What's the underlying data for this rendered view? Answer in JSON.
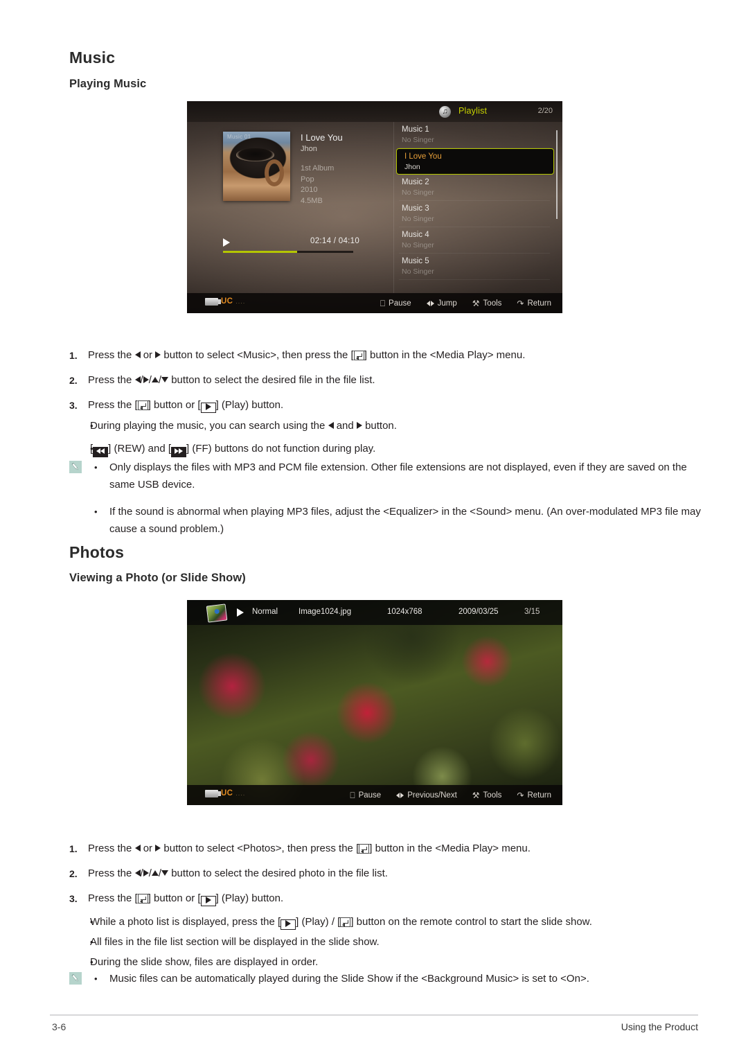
{
  "document": {
    "sections": [
      {
        "title": "Music",
        "subtitle": "Playing Music"
      },
      {
        "title": "Photos",
        "subtitle": "Viewing a Photo (or Slide Show)"
      }
    ]
  },
  "music_section": {
    "heading": "Music",
    "subheading": "Playing Music",
    "steps": [
      {
        "num": "1.",
        "parts": [
          "Press the ",
          " or ",
          " button to select <Music>, then press the [",
          "] button in the <Media Play> menu."
        ]
      },
      {
        "num": "2.",
        "parts": [
          "Press the ",
          "/",
          "/",
          "/",
          " button to select the desired file in the file list."
        ]
      },
      {
        "num": "3.",
        "parts": [
          "Press the [",
          "] button or [",
          "] (Play) button."
        ]
      }
    ],
    "bullets": [
      [
        "During playing the music, you can search using the ",
        " and ",
        " button."
      ],
      [
        "[",
        "] (REW) and [",
        "] (FF) buttons do not function during play."
      ]
    ],
    "notes": [
      "Only displays the files with MP3 and PCM file extension. Other file extensions are not displayed, even if they are saved on the same USB device.",
      "If the sound is abnormal when playing MP3 files, adjust the <Equalizer> in the <Sound> menu. (An over-modulated MP3 file may cause a sound problem.)"
    ]
  },
  "photos_section": {
    "heading": "Photos",
    "subheading": "Viewing a Photo (or Slide Show)",
    "steps": [
      {
        "num": "1.",
        "parts": [
          "Press the ",
          " or ",
          " button to select <Photos>, then press the [",
          "] button in the <Media Play> menu."
        ]
      },
      {
        "num": "2.",
        "parts": [
          "Press the ",
          "/",
          "/",
          "/",
          " button to select the desired photo in the file list."
        ]
      },
      {
        "num": "3.",
        "parts": [
          "Press the [",
          "] button or [",
          "] (Play) button."
        ]
      }
    ],
    "bullets": [
      [
        "While a photo list is displayed, press the [",
        "] (Play) / [",
        "] button on the remote control to start the slide show."
      ],
      [
        "All files in the file list section will be displayed in the slide show."
      ],
      [
        "During the slide show, files are displayed in order."
      ]
    ],
    "notes": [
      "Music files can be automatically played during the Slide Show if the <Background Music> is set to <On>."
    ]
  },
  "music_player": {
    "playlist_label": "Playlist",
    "count": "2/20",
    "album_art_caption": "Music 01",
    "now_playing": {
      "title": "I Love You",
      "artist": "Jhon",
      "album": "1st Album",
      "genre": "Pop",
      "year": "2010",
      "size": "4.5MB"
    },
    "elapsed_total": "02:14 / 04:10",
    "progress_percent": 57,
    "accent_color": "#b4c600",
    "selected_title_color": "#e8a03a",
    "playlist": [
      {
        "title": "Music 1",
        "artist": "No Singer",
        "selected": false
      },
      {
        "title": "I Love You",
        "artist": "Jhon",
        "selected": true
      },
      {
        "title": "Music 2",
        "artist": "No Singer",
        "selected": false
      },
      {
        "title": "Music 3",
        "artist": "No Singer",
        "selected": false
      },
      {
        "title": "Music 4",
        "artist": "No Singer",
        "selected": false
      },
      {
        "title": "Music 5",
        "artist": "No Singer",
        "selected": false
      }
    ],
    "bottom_bar": {
      "source": "UC",
      "source_dots": "....",
      "actions": [
        "Pause",
        "Jump",
        "Tools",
        "Return"
      ]
    }
  },
  "photo_viewer": {
    "mode": "Normal",
    "filename": "Image1024.jpg",
    "resolution": "1024x768",
    "date": "2009/03/25",
    "count": "3/15",
    "bottom_bar": {
      "source": "UC",
      "source_dots": "....",
      "actions": [
        "Pause",
        "Previous/Next",
        "Tools",
        "Return"
      ]
    }
  },
  "footer": {
    "page_number": "3-6",
    "chapter": "Using the Product"
  }
}
